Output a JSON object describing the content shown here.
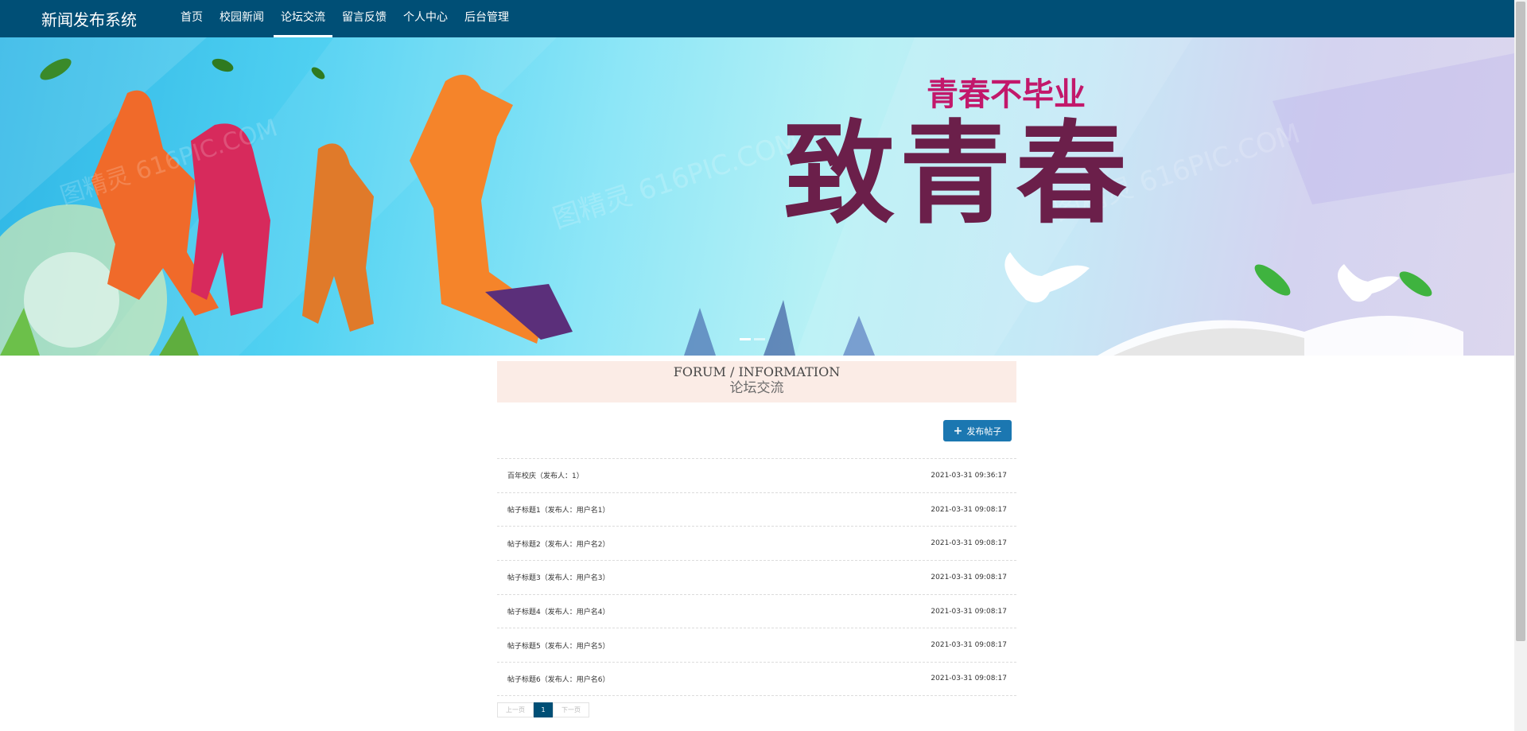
{
  "nav": {
    "brand": "新闻发布系统",
    "items": [
      {
        "label": "首页"
      },
      {
        "label": "校园新闻"
      },
      {
        "label": "论坛交流",
        "active": true
      },
      {
        "label": "留言反馈"
      },
      {
        "label": "个人中心"
      },
      {
        "label": "后台管理"
      }
    ]
  },
  "banner": {
    "title_big": "致青春",
    "title_small": "青春不毕业",
    "watermark": "图精灵 616PIC.COM",
    "slides": 2,
    "active_slide": 0
  },
  "section": {
    "title_en": "FORUM / INFORMATION",
    "title_cn": "论坛交流"
  },
  "post_button": {
    "icon": "plus-icon",
    "label": "发布帖子"
  },
  "posts": [
    {
      "title": "百年校庆（发布人：1）",
      "time": "2021-03-31 09:36:17"
    },
    {
      "title": "帖子标题1（发布人：用户名1）",
      "time": "2021-03-31 09:08:17"
    },
    {
      "title": "帖子标题2（发布人：用户名2）",
      "time": "2021-03-31 09:08:17"
    },
    {
      "title": "帖子标题3（发布人：用户名3）",
      "time": "2021-03-31 09:08:17"
    },
    {
      "title": "帖子标题4（发布人：用户名4）",
      "time": "2021-03-31 09:08:17"
    },
    {
      "title": "帖子标题5（发布人：用户名5）",
      "time": "2021-03-31 09:08:17"
    },
    {
      "title": "帖子标题6（发布人：用户名6）",
      "time": "2021-03-31 09:08:17"
    }
  ],
  "pagination": {
    "prev": "上一页",
    "current": "1",
    "next": "下一页"
  },
  "colors": {
    "navbar": "#004f76",
    "accent": "#1b77b1",
    "section_bg": "#fbece6"
  }
}
